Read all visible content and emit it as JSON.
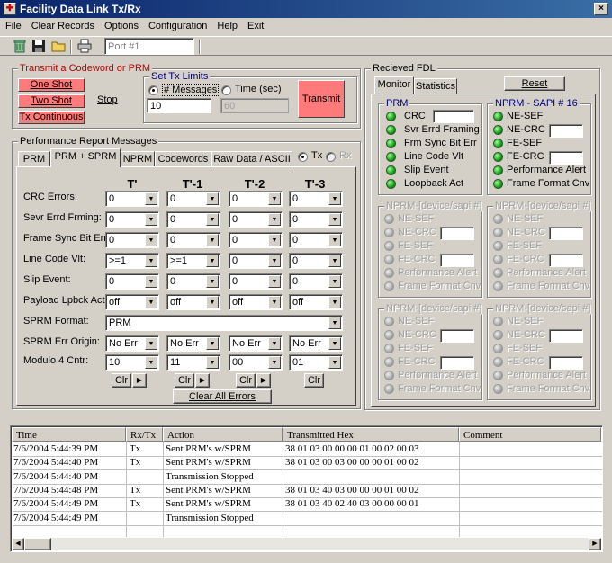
{
  "window": {
    "title": "Facility Data Link Tx/Rx",
    "close_glyph": "×"
  },
  "menu": [
    "File",
    "Clear Records",
    "Options",
    "Configuration",
    "Help",
    "Exit"
  ],
  "toolbar": {
    "port_field": "Port #1"
  },
  "transmit_group": {
    "title": "Transmit a Codeword or PRM",
    "one_shot": "One Shot",
    "two_shot": "Two Shot",
    "tx_continuous": "Tx Continuous",
    "stop": "Stop"
  },
  "tx_limits": {
    "title": "Set Tx Limits",
    "messages_label": "# Messages",
    "time_label": "Time (sec)",
    "messages_value": "10",
    "time_value": "60",
    "transmit": "Transmit"
  },
  "perf": {
    "title": "Performance Report  Messages",
    "tabs": [
      "PRM",
      "PRM + SPRM",
      "NPRM",
      "Codewords",
      "Raw Data / ASCII"
    ],
    "tx": "Tx",
    "rx": "Rx",
    "columns": [
      "T'",
      "T'-1",
      "T'-2",
      "T'-3"
    ],
    "rows": [
      {
        "label": "CRC Errors:",
        "values": [
          "0",
          "0",
          "0",
          "0"
        ]
      },
      {
        "label": "Sevr Errd Frming:",
        "values": [
          "0",
          "0",
          "0",
          "0"
        ]
      },
      {
        "label": "Frame Sync Bit Err:",
        "values": [
          "0",
          "0",
          "0",
          "0"
        ]
      },
      {
        "label": "Line Code Vlt:",
        "values": [
          ">=1",
          ">=1",
          "0",
          "0"
        ]
      },
      {
        "label": "Slip Event:",
        "values": [
          "0",
          "0",
          "0",
          "0"
        ]
      },
      {
        "label": "Payload Lpbck Act:",
        "values": [
          "off",
          "off",
          "off",
          "off"
        ]
      }
    ],
    "sprm_format_label": "SPRM Format:",
    "sprm_format_value": "PRM",
    "sprm_err_label": "SPRM Err Origin:",
    "sprm_err_values": [
      "No Err",
      "No Err",
      "No Err",
      "No Err"
    ],
    "modulo_label": "Modulo 4 Cntr:",
    "modulo_values": [
      "10",
      "11",
      "00",
      "01"
    ],
    "clr": "Clr",
    "clear_all": "Clear All Errors"
  },
  "fdl": {
    "title": "Recieved FDL",
    "tabs": [
      "Monitor",
      "Statistics"
    ],
    "reset": "Reset",
    "prm": {
      "title": "PRM",
      "items": [
        "CRC",
        "Svr Errd Framing",
        "Frm Sync Bit Err",
        "Line Code Vlt",
        "Slip Event",
        "Loopback Act"
      ]
    },
    "nprm_active": {
      "title": "NPRM - SAPI # 16",
      "items": [
        "NE-SEF",
        "NE-CRC",
        "FE-SEF",
        "FE-CRC",
        "Performance Alert",
        "Frame Format Cnv"
      ]
    },
    "nprm_inactive": {
      "title": "NPRM-[device/sapi #]",
      "items": [
        "NE-SEF",
        "NE-CRC",
        "FE-SEF",
        "FE-CRC",
        "Performance Alert",
        "Frame Format Cnv"
      ]
    }
  },
  "log": {
    "columns": [
      "Time",
      "Rx/Tx",
      "Action",
      "Transmitted Hex",
      "Comment"
    ],
    "rows": [
      {
        "time": "7/6/2004 5:44:39 PM",
        "rxtx": "Tx",
        "action": "Sent PRM's w/SPRM",
        "hex": "38 01 03 00 00 00 01 00 02 00 03",
        "comment": ""
      },
      {
        "time": "7/6/2004 5:44:40 PM",
        "rxtx": "Tx",
        "action": "Sent PRM's w/SPRM",
        "hex": "38 01 03 00 03 00 00 00 01 00 02",
        "comment": ""
      },
      {
        "time": "7/6/2004 5:44:40 PM",
        "rxtx": "",
        "action": "Transmission Stopped",
        "hex": "",
        "comment": ""
      },
      {
        "time": "7/6/2004 5:44:48 PM",
        "rxtx": "Tx",
        "action": "Sent PRM's w/SPRM",
        "hex": "38 01 03 40 03 00 00 00 01 00 02",
        "comment": ""
      },
      {
        "time": "7/6/2004 5:44:49 PM",
        "rxtx": "Tx",
        "action": "Sent PRM's w/SPRM",
        "hex": "38 01 03 40 02 40 03 00 00 00 01",
        "comment": ""
      },
      {
        "time": "7/6/2004 5:44:49 PM",
        "rxtx": "",
        "action": "Transmission Stopped",
        "hex": "",
        "comment": ""
      }
    ]
  }
}
